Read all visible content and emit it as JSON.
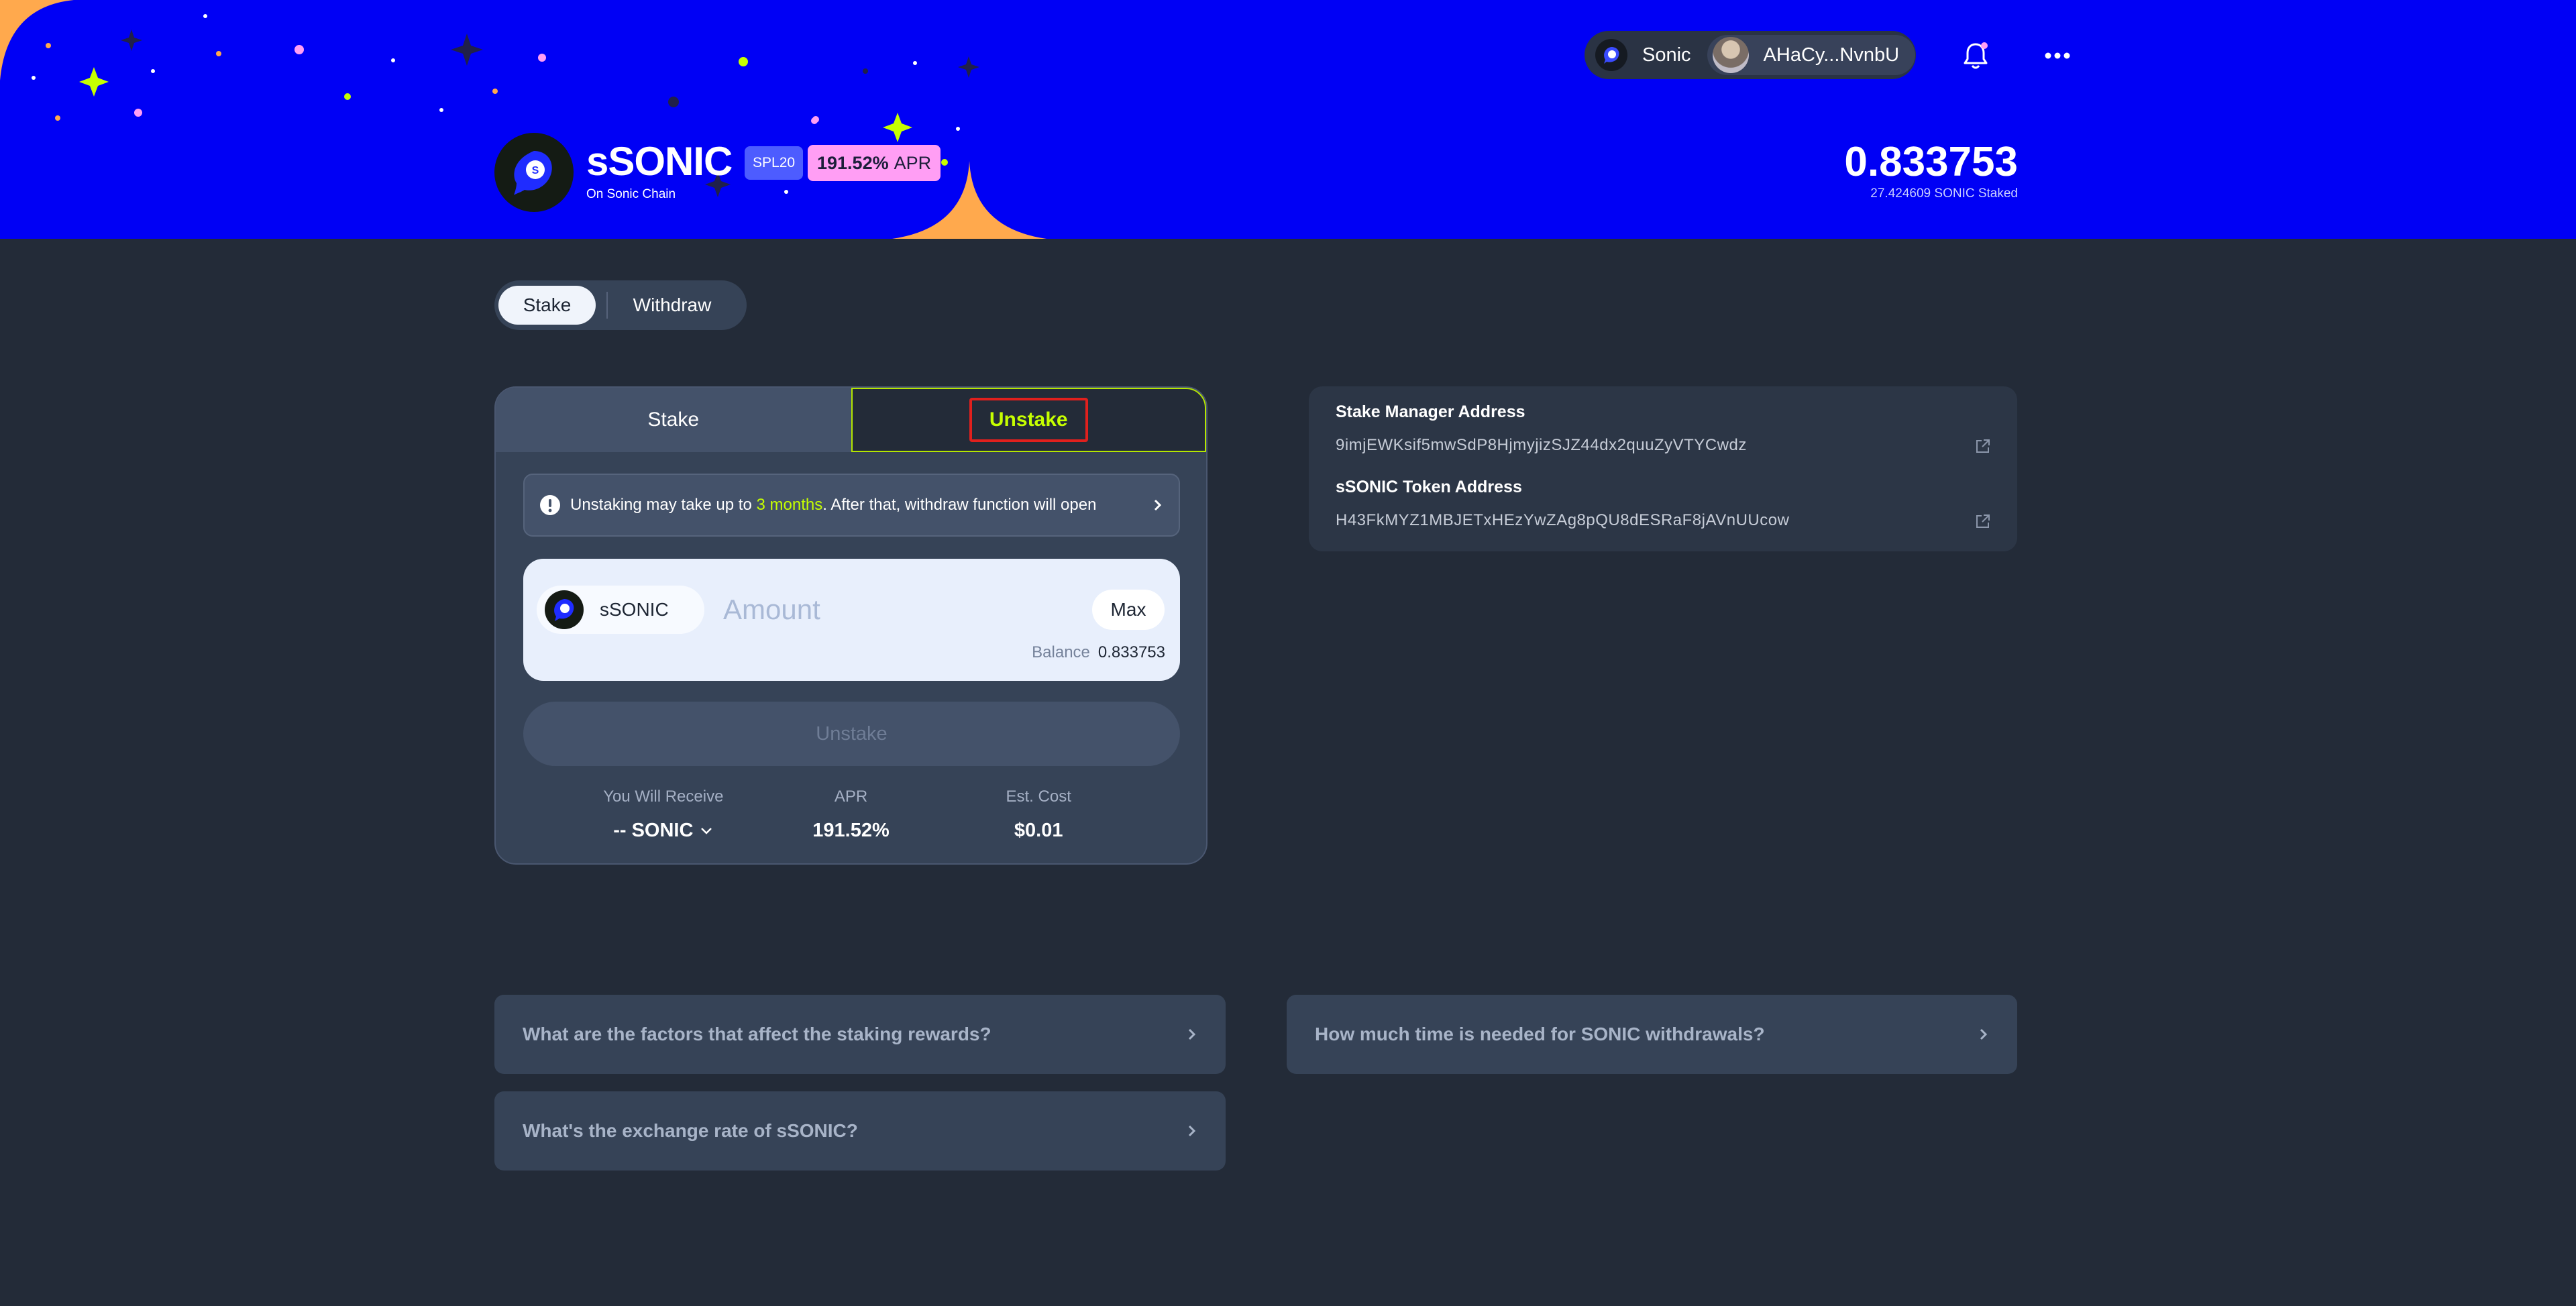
{
  "header": {
    "token_name": "sSONIC",
    "token_chain": "On Sonic Chain",
    "badge_standard": "SPL20",
    "badge_apr_value": "191.52%",
    "badge_apr_label": "APR",
    "staked_balance": "0.833753",
    "staked_sub": "27.424609 SONIC Staked",
    "network_label": "Sonic",
    "wallet_address": "AHaCy...NvnbU",
    "icons": [
      "sonic-logo-icon",
      "bell-icon",
      "more-icon"
    ]
  },
  "mode_tabs": [
    {
      "label": "Stake",
      "active": true
    },
    {
      "label": "Withdraw",
      "active": false
    }
  ],
  "card": {
    "tabs": [
      {
        "label": "Stake",
        "active": false
      },
      {
        "label": "Unstake",
        "active": true
      }
    ],
    "notice_prefix": "Unstaking may take up to ",
    "notice_highlight": "3 months",
    "notice_suffix": ". After that, withdraw function will open",
    "token_label": "sSONIC",
    "amount_placeholder": "Amount",
    "max_label": "Max",
    "balance_label": "Balance",
    "balance_value": "0.833753",
    "submit_label": "Unstake",
    "stats": [
      {
        "label": "You Will Receive",
        "value": "-- SONIC"
      },
      {
        "label": "APR",
        "value": "191.52%"
      },
      {
        "label": "Est. Cost",
        "value": "$0.01"
      }
    ]
  },
  "addresses": [
    {
      "title": "Stake Manager Address",
      "value": "9imjEWKsif5mwSdP8HjmyjizSJZ44dx2quuZyVTYCwdz"
    },
    {
      "title": "sSONIC Token Address",
      "value": "H43FkMYZ1MBJETxHEzYwZAg8pQU8dESRaF8jAVnUUcow"
    }
  ],
  "faq": [
    "What are the factors that affect the staking rewards?",
    "How much time is needed for SONIC withdrawals?",
    "What's the exchange rate of sSONIC?"
  ],
  "colors": {
    "hero_bg": "#0000f5",
    "page_bg": "#232b38",
    "accent_lime": "#c6ff00",
    "apr_badge": "#ff9ef4",
    "spl_badge": "#4d5cff",
    "highlight_border": "#e0201d"
  }
}
